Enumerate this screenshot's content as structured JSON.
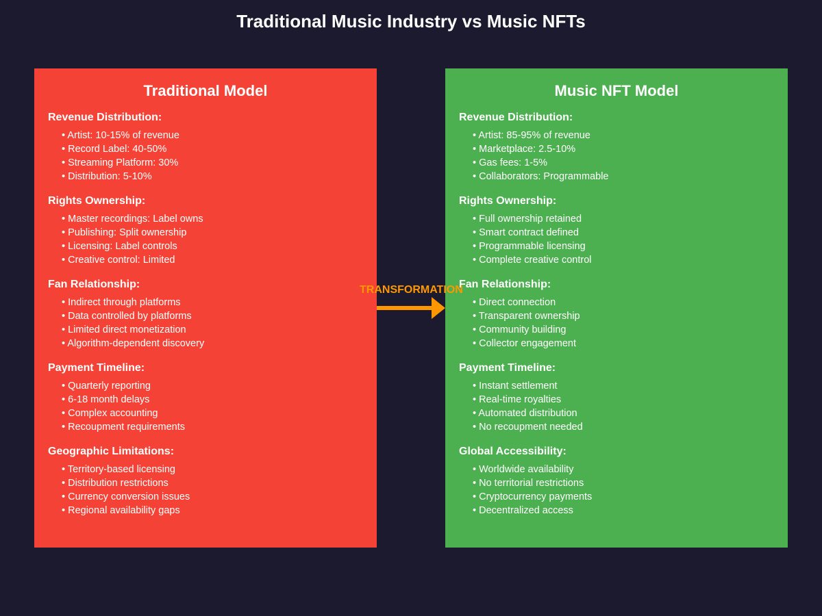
{
  "title": "Traditional Music Industry vs Music NFTs",
  "colors": {
    "background": "#1b1a2e",
    "traditional_panel": "#f44336",
    "nft_panel": "#4caf50",
    "transformation": "#ff9800",
    "text": "#ffffff"
  },
  "traditional": {
    "title": "Traditional Model",
    "sections": [
      {
        "heading": "Revenue Distribution:",
        "items": [
          "Artist: 10-15% of revenue",
          "Record Label: 40-50%",
          "Streaming Platform: 30%",
          "Distribution: 5-10%"
        ]
      },
      {
        "heading": "Rights Ownership:",
        "items": [
          "Master recordings: Label owns",
          "Publishing: Split ownership",
          "Licensing: Label controls",
          "Creative control: Limited"
        ]
      },
      {
        "heading": "Fan Relationship:",
        "items": [
          "Indirect through platforms",
          "Data controlled by platforms",
          "Limited direct monetization",
          "Algorithm-dependent discovery"
        ]
      },
      {
        "heading": "Payment Timeline:",
        "items": [
          "Quarterly reporting",
          "6-18 month delays",
          "Complex accounting",
          "Recoupment requirements"
        ]
      },
      {
        "heading": "Geographic Limitations:",
        "items": [
          "Territory-based licensing",
          "Distribution restrictions",
          "Currency conversion issues",
          "Regional availability gaps"
        ]
      }
    ]
  },
  "nft": {
    "title": "Music NFT Model",
    "sections": [
      {
        "heading": "Revenue Distribution:",
        "items": [
          "Artist: 85-95% of revenue",
          "Marketplace: 2.5-10%",
          "Gas fees: 1-5%",
          "Collaborators: Programmable"
        ]
      },
      {
        "heading": "Rights Ownership:",
        "items": [
          "Full ownership retained",
          "Smart contract defined",
          "Programmable licensing",
          "Complete creative control"
        ]
      },
      {
        "heading": "Fan Relationship:",
        "items": [
          "Direct connection",
          "Transparent ownership",
          "Community building",
          "Collector engagement"
        ]
      },
      {
        "heading": "Payment Timeline:",
        "items": [
          "Instant settlement",
          "Real-time royalties",
          "Automated distribution",
          "No recoupment needed"
        ]
      },
      {
        "heading": "Global Accessibility:",
        "items": [
          "Worldwide availability",
          "No territorial restrictions",
          "Cryptocurrency payments",
          "Decentralized access"
        ]
      }
    ]
  },
  "transformation": {
    "label": "TRANSFORMATION",
    "arrow_icon": "arrow-right-icon"
  }
}
